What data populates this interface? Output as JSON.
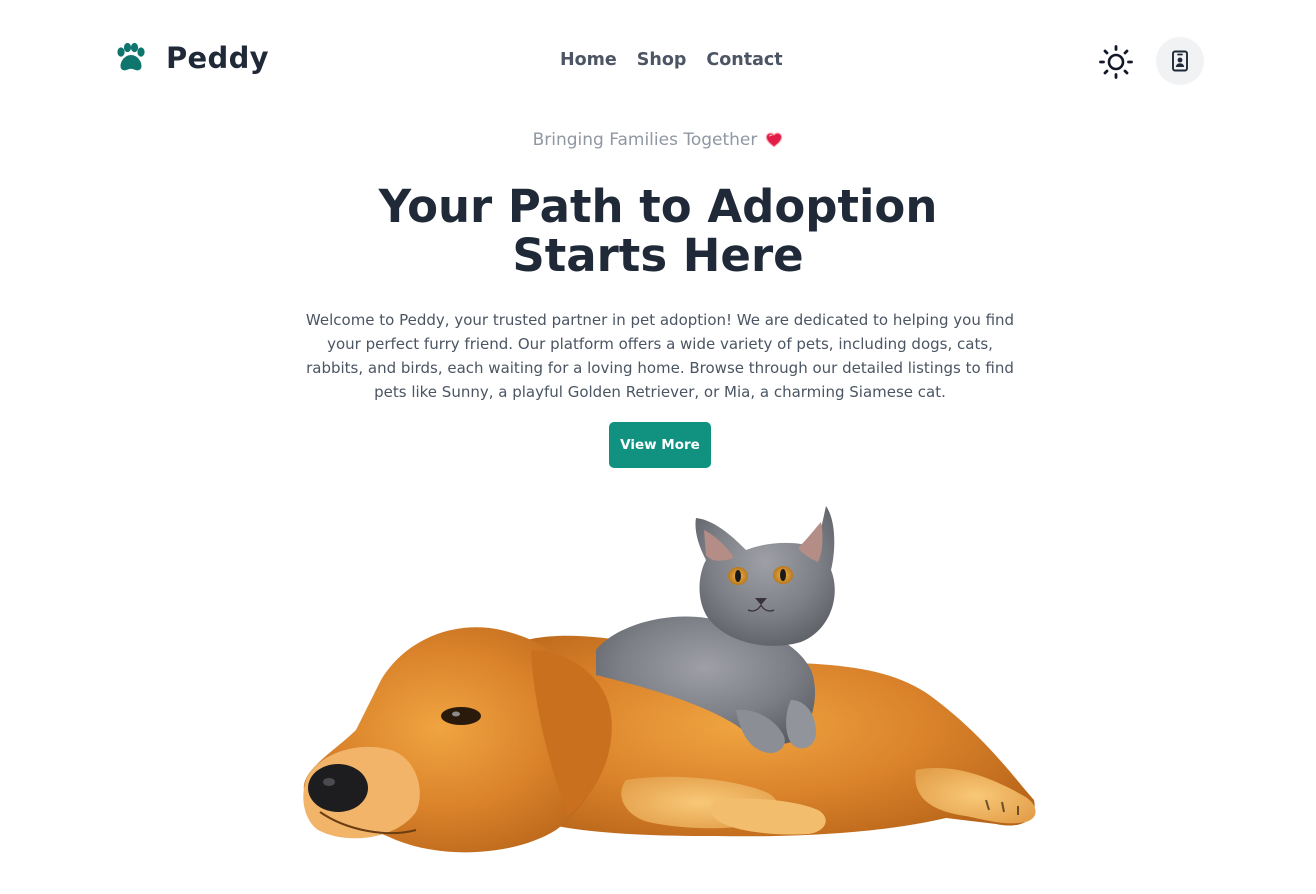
{
  "brand": {
    "name": "Peddy",
    "icon": "paw-icon",
    "icon_color": "#0f766e"
  },
  "nav": {
    "links": [
      {
        "label": "Home"
      },
      {
        "label": "Shop"
      },
      {
        "label": "Contact"
      }
    ]
  },
  "header_actions": {
    "theme_icon": "sun-icon",
    "profile_icon": "profile-badge-icon"
  },
  "hero": {
    "tagline": "Bringing Families Together",
    "tagline_icon": "heart-icon",
    "title_line1": "Your Path to Adoption",
    "title_line2": "Starts Here",
    "description": "Welcome to Peddy, your trusted partner in pet adoption! We are dedicated to helping you find your perfect furry friend. Our platform offers a wide variety of pets, including dogs, cats, rabbits, and birds, each waiting for a loving home. Browse through our detailed listings to find pets like Sunny, a playful Golden Retriever, or Mia, a charming Siamese cat.",
    "cta_label": "View More",
    "image": "golden-retriever-with-gray-kitten"
  },
  "colors": {
    "accent": "#119280",
    "heading": "#1f2937",
    "muted": "#8f97a3",
    "body": "#4b5563",
    "profile_bg": "#f1f2f4"
  }
}
